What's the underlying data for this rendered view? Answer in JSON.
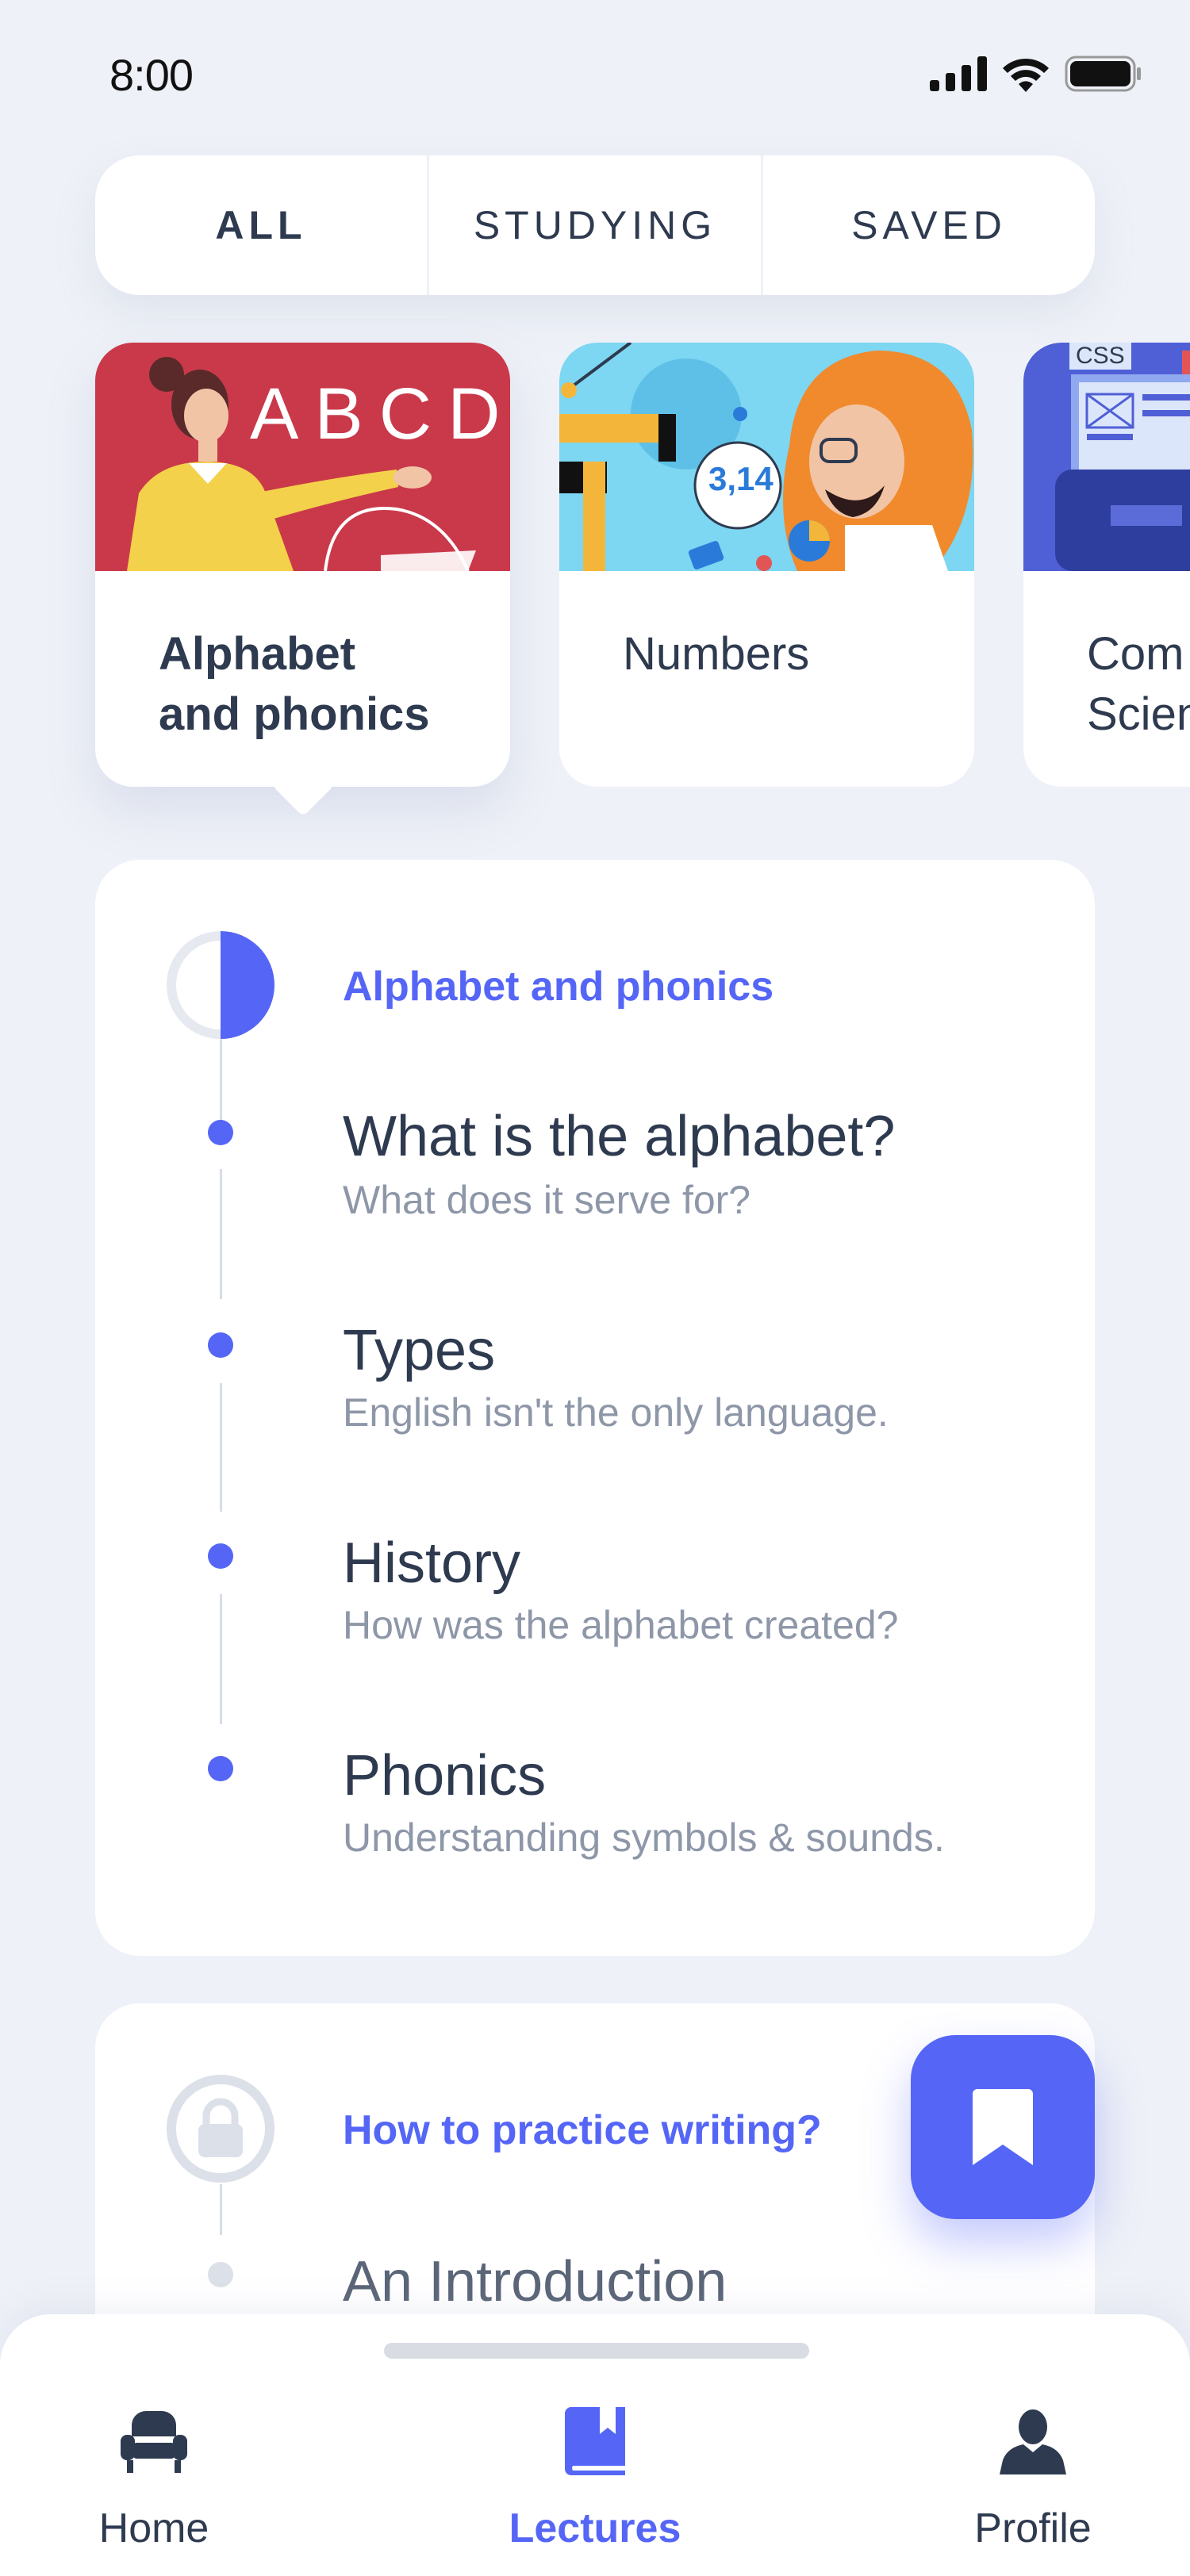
{
  "status_bar": {
    "time": "8:00"
  },
  "tabs": [
    {
      "label": "ALL",
      "active": true
    },
    {
      "label": "STUDYING",
      "active": false
    },
    {
      "label": "SAVED",
      "active": false
    }
  ],
  "categories": [
    {
      "label_line1": "Alphabet",
      "label_line2": "and phonics",
      "art_text": "ABCD",
      "selected": true
    },
    {
      "label_line1": "Numbers",
      "label_line2": "",
      "art_text": "3,14",
      "selected": false
    },
    {
      "label_line1": "Com",
      "label_line2": "Scien",
      "art_text": "CSS",
      "selected": false
    }
  ],
  "lecture": {
    "title": "Alphabet and phonics",
    "progress": 0.5,
    "lessons": [
      {
        "title": "What is the alphabet?",
        "subtitle": "What does it serve for?"
      },
      {
        "title": "Types",
        "subtitle": "English isn't the only language."
      },
      {
        "title": "History",
        "subtitle": "How was the alphabet created?"
      },
      {
        "title": "Phonics",
        "subtitle": "Understanding symbols & sounds."
      }
    ]
  },
  "locked_lecture": {
    "title": "How to practice writing?",
    "first_lesson": "An Introduction"
  },
  "bottom_nav": [
    {
      "label": "Home",
      "icon": "armchair-icon",
      "active": false
    },
    {
      "label": "Lectures",
      "icon": "book-icon",
      "active": true
    },
    {
      "label": "Profile",
      "icon": "person-icon",
      "active": false
    }
  ],
  "colors": {
    "accent": "#5566F6",
    "background": "#EEF1F7",
    "text": "#2E3A4F",
    "muted": "#8E97A8"
  }
}
